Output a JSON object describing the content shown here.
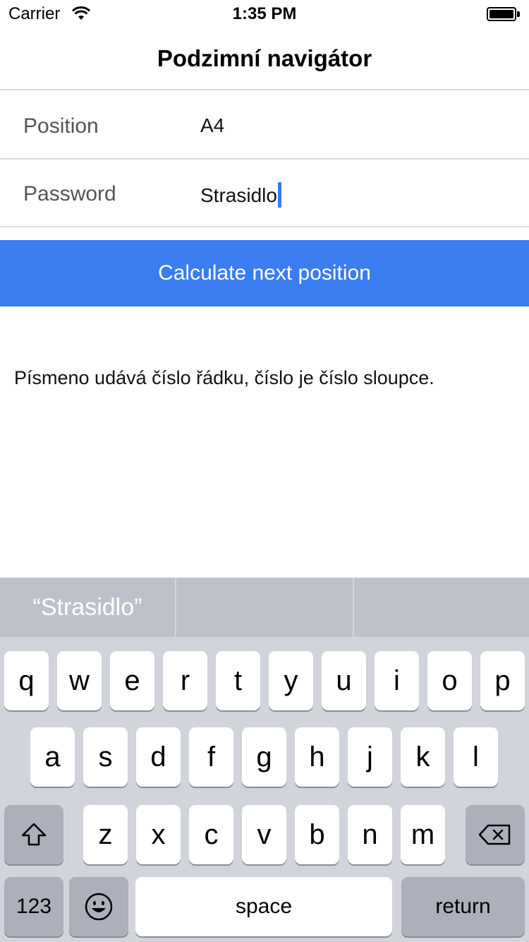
{
  "status_bar": {
    "carrier": "Carrier",
    "time": "1:35 PM"
  },
  "nav": {
    "title": "Podzimní navigátor"
  },
  "form": {
    "position": {
      "label": "Position",
      "value": "A4"
    },
    "password": {
      "label": "Password",
      "value": "Strasidlo"
    }
  },
  "actions": {
    "calculate_label": "Calculate next position",
    "button_color": "#3a7df1"
  },
  "help_text": "Písmeno udává číslo řádku, číslo je číslo sloupce.",
  "keyboard": {
    "suggestion_1": "“Strasidlo”",
    "row1": [
      "q",
      "w",
      "e",
      "r",
      "t",
      "y",
      "u",
      "i",
      "o",
      "p"
    ],
    "row2": [
      "a",
      "s",
      "d",
      "f",
      "g",
      "h",
      "j",
      "k",
      "l"
    ],
    "row3": [
      "z",
      "x",
      "c",
      "v",
      "b",
      "n",
      "m"
    ],
    "numbers_label": "123",
    "space_label": "space",
    "return_label": "return",
    "icons": {
      "shift": "shift-icon",
      "backspace": "backspace-icon",
      "emoji": "emoji-icon"
    }
  }
}
